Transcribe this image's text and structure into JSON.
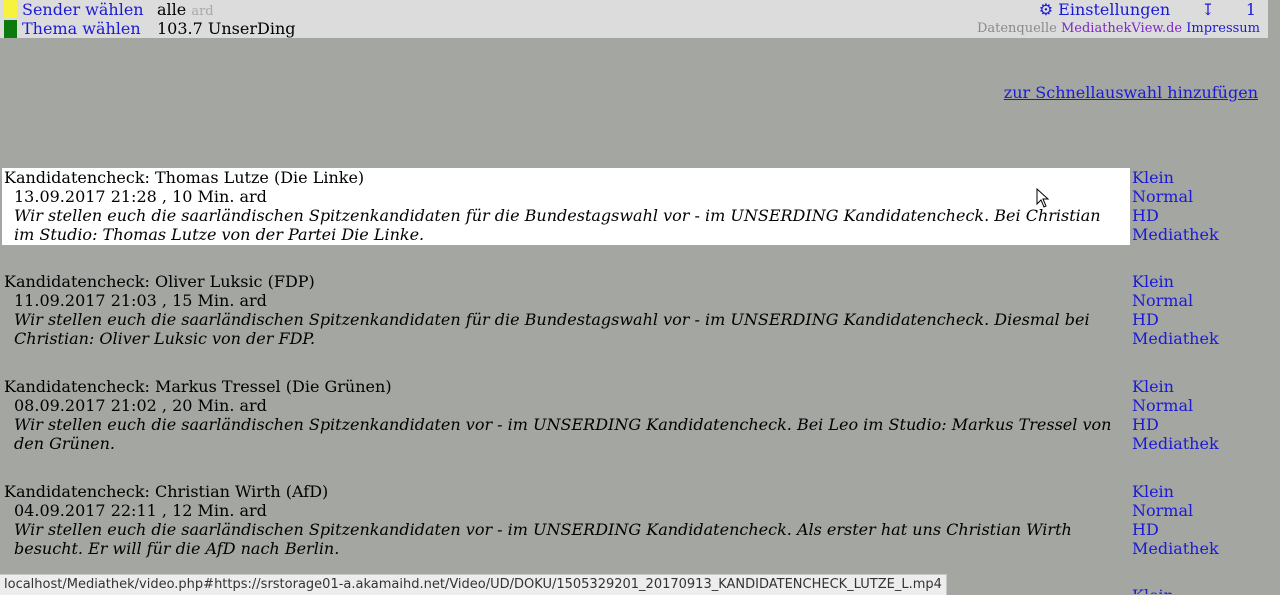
{
  "header": {
    "sender_label": "Sender wählen",
    "sender_value": "alle",
    "sender_sub": "ard",
    "thema_label": "Thema wählen",
    "thema_value": "103.7 UnserDing",
    "settings_label": "⚙ Einstellungen",
    "sort_icon": "↧",
    "page_number": "1",
    "source_prefix": "Datenquelle",
    "source_link": "MediathekView.de",
    "impressum": "Impressum",
    "colors": {
      "sender": "#f7f33d",
      "thema": "#0d7a0d"
    }
  },
  "quick_add": "zur Schnellauswahl hinzufügen",
  "entries": [
    {
      "title": "Kandidatencheck: Thomas Lutze (Die Linke)",
      "meta": "13.09.2017 21:28 , 10 Min. ard",
      "desc": "Wir stellen euch die saarländischen Spitzenkandidaten für die Bundestagswahl vor - im UNSERDING Kandidatencheck. Bei Christian im Studio: Thomas Lutze von der Partei Die Linke."
    },
    {
      "title": "Kandidatencheck: Oliver Luksic (FDP)",
      "meta": "11.09.2017 21:03 , 15 Min. ard",
      "desc": "Wir stellen euch die saarländischen Spitzenkandidaten für die Bundestagswahl vor - im UNSERDING Kandidatencheck. Diesmal bei Christian: Oliver Luksic von der FDP."
    },
    {
      "title": "Kandidatencheck: Markus Tressel (Die Grünen)",
      "meta": "08.09.2017 21:02 , 20 Min. ard",
      "desc": "Wir stellen euch die saarländischen Spitzenkandidaten vor - im UNSERDING Kandidatencheck. Bei Leo im Studio: Markus Tressel von den Grünen."
    },
    {
      "title": "Kandidatencheck: Christian Wirth (AfD)",
      "meta": "04.09.2017 22:11 , 12 Min. ard",
      "desc": "Wir stellen euch die saarländischen Spitzenkandidaten vor - im UNSERDING Kandidatencheck. Als erster hat uns Christian Wirth besucht. Er will für die AfD nach Berlin."
    }
  ],
  "links": {
    "klein": "Klein",
    "normal": "Normal",
    "hd": "HD",
    "mediathek": "Mediathek"
  },
  "status_url": "localhost/Mediathek/video.php#https://srstorage01-a.akamaihd.net/Video/UD/DOKU/1505329201_20170913_KANDIDATENCHECK_LUTZE_L.mp4"
}
